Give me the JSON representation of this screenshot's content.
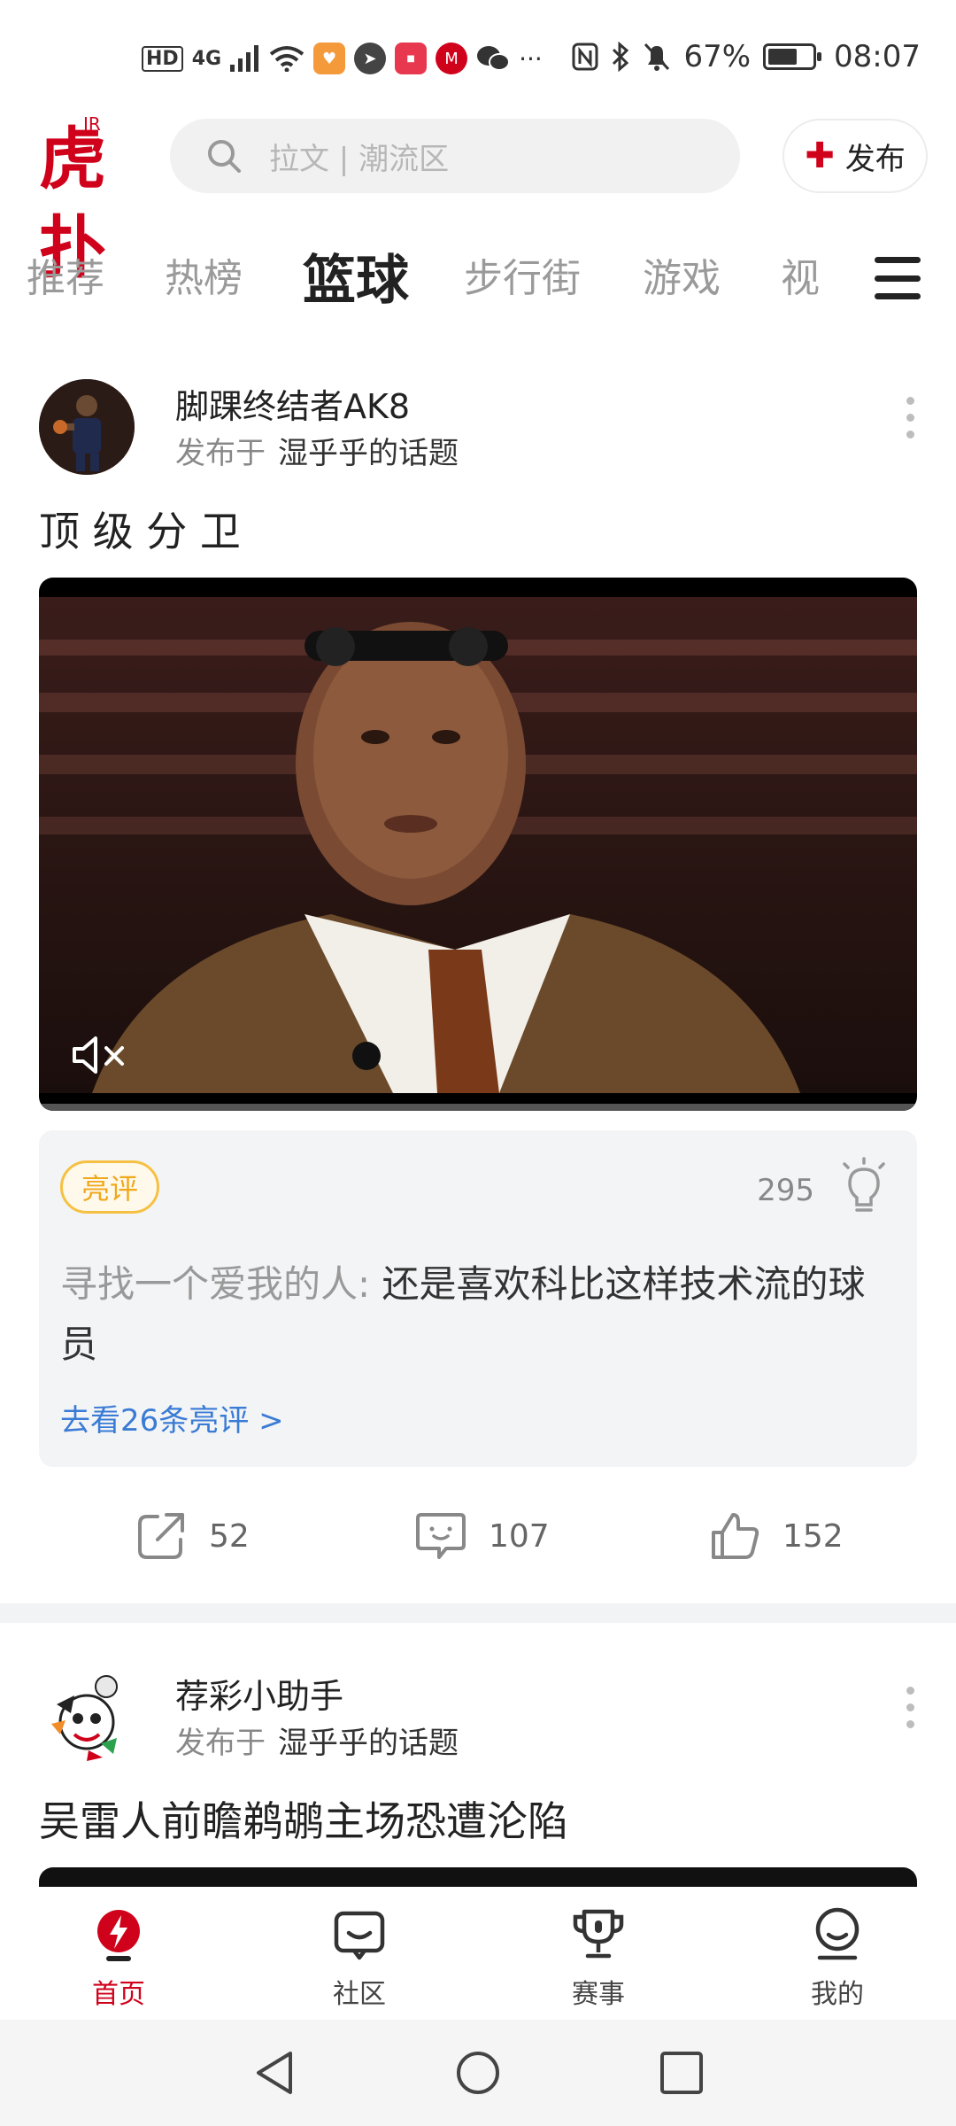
{
  "status_bar": {
    "network": "4G",
    "hd": "HD",
    "more": "···",
    "battery_text": "67%",
    "battery_level": 0.67,
    "time": "08:07"
  },
  "header": {
    "logo_text": "虎扑",
    "logo_sup": "JR",
    "search_placeholder": "拉文 | 潮流区",
    "publish_label": "发布",
    "accent": "#d0021b"
  },
  "tabs": [
    {
      "label": "推荐",
      "active": false
    },
    {
      "label": "热榜",
      "active": false
    },
    {
      "label": "篮球",
      "active": true
    },
    {
      "label": "步行街",
      "active": false
    },
    {
      "label": "游戏",
      "active": false
    },
    {
      "label": "视",
      "active": false
    }
  ],
  "posts": [
    {
      "author": "脚踝终结者AK8",
      "published_prefix": "发布于",
      "topic": "湿乎乎的话题",
      "title": "顶 级 分 卫",
      "highlight": {
        "badge": "亮评",
        "likes": "295",
        "user": "寻找一个爱我的人:",
        "text": "还是喜欢科比这样技术流的球员",
        "see_more": "去看26条亮评 >"
      },
      "actions": {
        "share": "52",
        "comments": "107",
        "likes": "152"
      }
    },
    {
      "author": "荐彩小助手",
      "published_prefix": "发布于",
      "topic": "湿乎乎的话题",
      "title": "吴雷人前瞻鹈鹕主场恐遭沦陷"
    }
  ],
  "bottom_nav": [
    {
      "label": "首页",
      "icon": "home-bolt-icon",
      "active": true
    },
    {
      "label": "社区",
      "icon": "community-icon",
      "active": false
    },
    {
      "label": "赛事",
      "icon": "trophy-icon",
      "active": false
    },
    {
      "label": "我的",
      "icon": "profile-icon",
      "active": false
    }
  ]
}
